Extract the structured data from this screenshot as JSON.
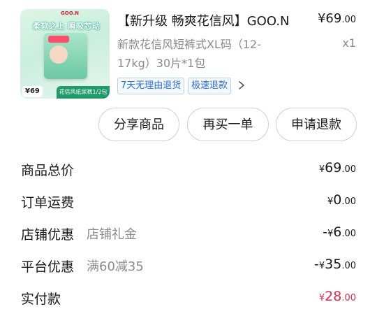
{
  "product": {
    "image_brand": "GOO.N",
    "image_slogan": "柔软之上 瞬吸芯动",
    "image_price": "¥69",
    "image_caption": "花信风纸尿裤1/2包",
    "title": "【新升级 畅爽花信风】GOO.N",
    "price_symbol": "¥",
    "price_int": "69",
    "price_dec": ".00",
    "sku": "新款花信风短裤式XL码（12-17kg）30片*1包",
    "quantity": "x1",
    "tags": [
      "7天无理由退货",
      "极速退款"
    ]
  },
  "actions": {
    "share": "分享商品",
    "rebuy": "再买一单",
    "refund": "申请退款"
  },
  "summary": [
    {
      "label": "商品总价",
      "desc": "",
      "sign": "",
      "cur": "¥",
      "int": "69",
      "dec": ".00"
    },
    {
      "label": "订单运费",
      "desc": "",
      "sign": "",
      "cur": "¥",
      "int": "0",
      "dec": ".00"
    },
    {
      "label": "店铺优惠",
      "desc": "店铺礼金",
      "sign": "-",
      "cur": "¥",
      "int": "6",
      "dec": ".00"
    },
    {
      "label": "平台优惠",
      "desc": "满60减35",
      "sign": "-",
      "cur": "¥",
      "int": "35",
      "dec": ".00"
    },
    {
      "label": "实付款",
      "desc": "",
      "sign": "",
      "cur": "¥",
      "int": "28",
      "dec": ".00"
    }
  ],
  "colors": {
    "accent_red": "#e3284c",
    "tag_blue": "#2b6cd8"
  }
}
